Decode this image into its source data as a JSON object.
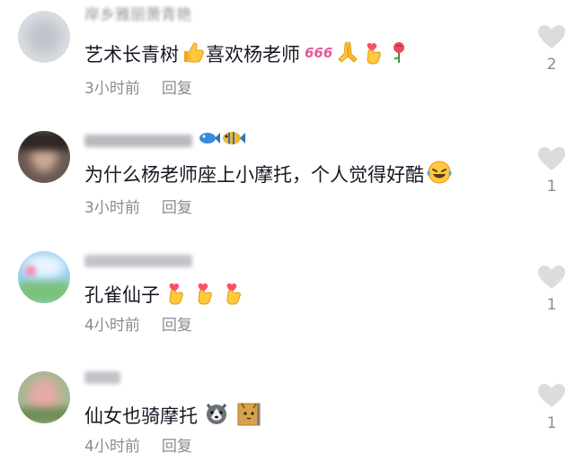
{
  "comments": [
    {
      "username": "岸乡雅丽萧青艳",
      "text": "艺术长青树",
      "text_after": "喜欢杨老师",
      "time": "3小时前",
      "reply": "回复",
      "likes": "2",
      "emojis": [
        "thumbs-up-icon",
        "666-icon",
        "praying-hands-icon",
        "finger-heart-icon",
        "rose-icon"
      ]
    },
    {
      "username": "",
      "text": "为什么杨老师座上小摩托，个人觉得好酷",
      "time": "3小时前",
      "reply": "回复",
      "likes": "1",
      "emojis": [
        "fish-icon",
        "tropical-fish-icon",
        "laughing-tears-icon"
      ]
    },
    {
      "username": "",
      "text": "孔雀仙子",
      "time": "4小时前",
      "reply": "回复",
      "likes": "1",
      "emojis": [
        "finger-heart-icon",
        "finger-heart-icon",
        "finger-heart-icon"
      ]
    },
    {
      "username": "",
      "text": "仙女也骑摩托",
      "time": "4小时前",
      "reply": "回复",
      "likes": "1",
      "emojis": [
        "husky-icon",
        "cat-icon"
      ]
    }
  ]
}
